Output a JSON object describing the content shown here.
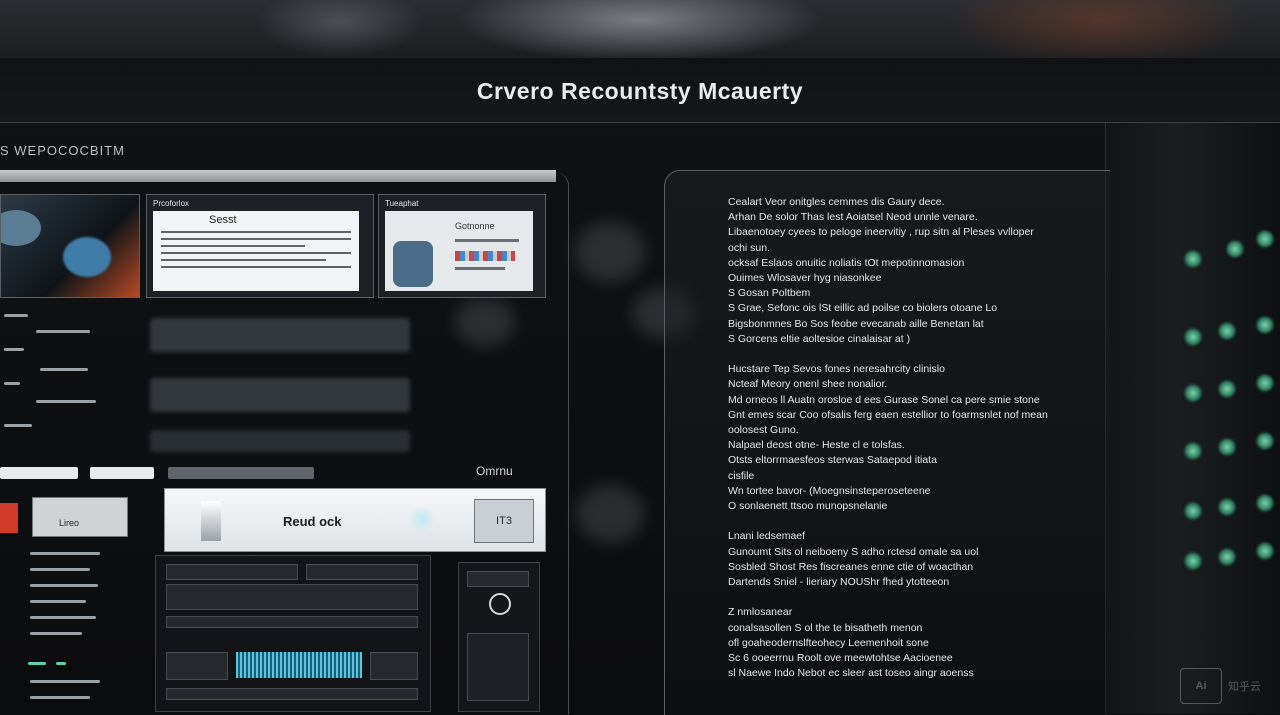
{
  "header": {
    "title": "Crvero Recountsty Mcauerty"
  },
  "left_panel": {
    "section_label": "S WEPOCOCBITM",
    "cards": [
      {
        "title": "Prcoforlox",
        "doc_heading": "Sesst"
      },
      {
        "title": "Tueaphat",
        "doc_heading": "Gotnonne"
      }
    ],
    "bottom_tab_label": "Omrnu",
    "status_label": "Lireo",
    "readlock": {
      "label": "Reud ock",
      "icon_text": "IT3"
    }
  },
  "right_panel": {
    "lines": [
      "Cealart  Veor onitgles cemmes dis  Gaury dece.",
      "Arhan De solor Thas lest Aoiatsel Neod unnle venare.",
      "Libaenotoey cyees to peloge ineervitiy , rup sitn al Pleses vvlloper",
      "ochi sun.",
      "ocksaf  Eslaos onuitic noliatis  tOt mepotinnomasion",
      "Ouimes  Wlosaver hyg niasonkee",
      "S Gosan  Poltbem",
      "S Grae,   Sefonc ois lSt eillic ad poilse  co biolers otoane Lo",
      "Bigsbonmnes Bo  Sos feobe evecanab aille Benetan lat",
      "S                       Gorcens eltie aoltesioe cinalaisar at )",
      "",
      "Hucstare  Tep Sevos fones neresahrcity clinislo",
      "Ncteaf  Meory onenl shee nonalior.",
      "Md orneos ll  Auatn orosloe d ees Gurase Sonel ca pere smie  stone",
      "Gnt emes scar  Coo ofsalis ferg  eaen estellior to foarmsnlet nof mean",
      "oolosest Guno.",
      "Nalpael deost otne-  Heste cl e tolsfas.",
      "Otsts  eltorrmaesfeos sterwas Sataepod itiata",
      "cisfile",
      "Wn tortee bavor-  (Moegnsinsteperoseteene",
      "O   sonlaenett  ttsoo  munopsnelanie",
      "",
      "Lnani ledsemaef",
      "Gunoumt  Sits ol neiboeny S adho rctesd omale sa uol",
      "Sosbled Shost  Res fiscreanes enne ctie  of woacthan",
      "Dartends Sniel  -  lieriary NOUShr fhed  ytotteeon",
      "",
      "Z nmlosanear",
      "conalsasollen  S ol  the  te bisatheth menon",
      "ofl  goaheodernslfteohecy  Leemenhoit sone",
      "Sc  6 ooeerrnu Roolt  ove  meewtohtse  Aacioenee",
      "sl  Naewe Indo Nebot ec sleer ast toseo aingr aoenss"
    ]
  },
  "watermark": {
    "logo_text": "Ai",
    "label": "知乎云"
  },
  "colors": {
    "background": "#0b0d10",
    "led_green": "#7fd9b0",
    "accent_red": "#d23a2a",
    "waveform_cyan": "#58c6e0"
  }
}
